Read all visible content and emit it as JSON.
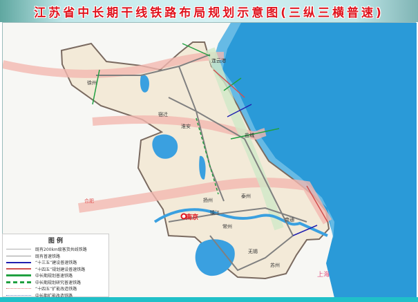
{
  "title": "江苏省中长期干线铁路布局规划示意图(三纵三横普速)",
  "legend": {
    "heading": "图 例",
    "items": [
      {
        "label": "既有200km级客货共线铁路",
        "color": "#b0b0b0",
        "style": "solid"
      },
      {
        "label": "既有普速铁路",
        "color": "#9a9a9a",
        "style": "solid"
      },
      {
        "label": "“十三五”建设普速铁路",
        "color": "#2020b0",
        "style": "solid"
      },
      {
        "label": "“十四五”规划建设普速铁路",
        "color": "#d05050",
        "style": "solid"
      },
      {
        "label": "中长期规划普速铁路",
        "color": "#20a040",
        "style": "solid"
      },
      {
        "label": "中长期规划研究普速铁路",
        "color": "#20a040",
        "style": "dashed"
      },
      {
        "label": "“十四五”扩能改造铁路",
        "color": "#e07070",
        "style": "dotted"
      },
      {
        "label": "中长期扩能改造铁路",
        "color": "#6080c0",
        "style": "dotted"
      }
    ]
  },
  "cities": [
    {
      "name": "连云港"
    },
    {
      "name": "徐州"
    },
    {
      "name": "宿迁"
    },
    {
      "name": "淮安"
    },
    {
      "name": "盐城"
    },
    {
      "name": "扬州"
    },
    {
      "name": "泰州"
    },
    {
      "name": "南京"
    },
    {
      "name": "南通"
    },
    {
      "name": "镇江"
    },
    {
      "name": "常州"
    },
    {
      "name": "无锡"
    },
    {
      "name": "苏州"
    },
    {
      "name": "上海"
    },
    {
      "name": "合肥"
    }
  ],
  "colors": {
    "sea": "#2a9ad8",
    "land": "#f3ead8",
    "corridor": "#f2b8b0",
    "green_band": "#cfe8c8"
  }
}
